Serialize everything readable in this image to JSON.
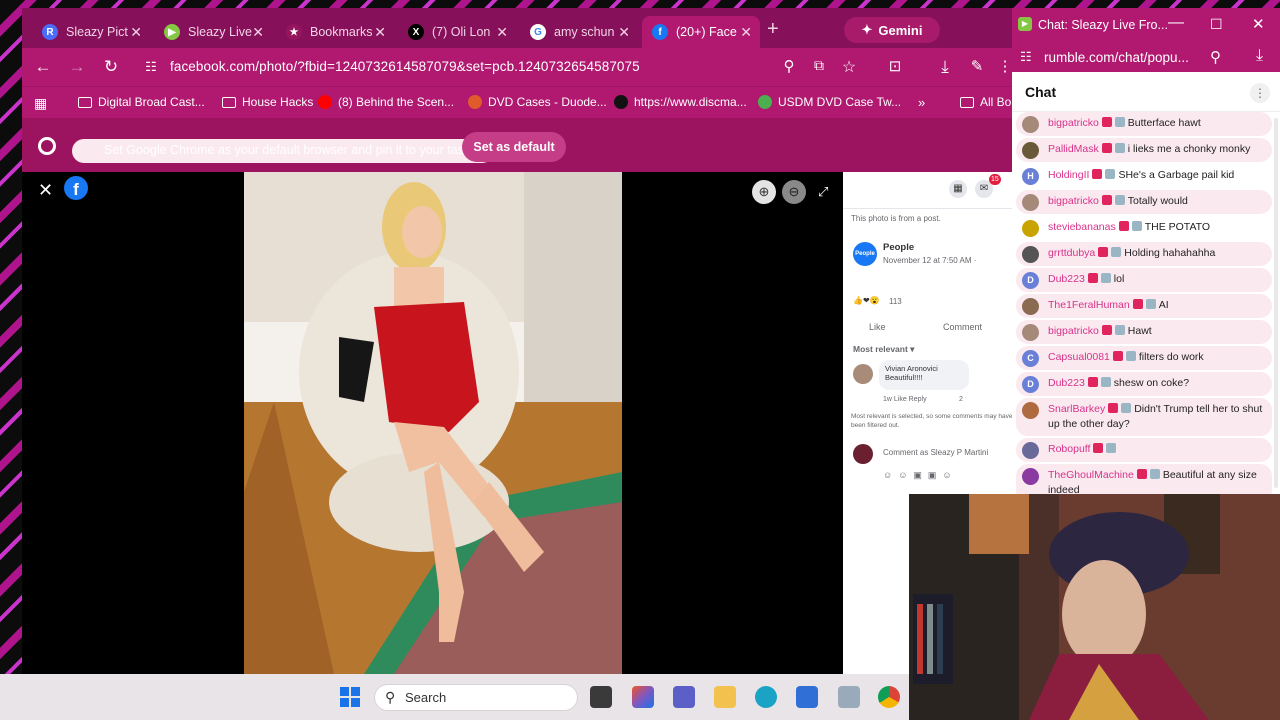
{
  "tabs": [
    {
      "label": "Sleazy Pict",
      "icon": "rumble-r-icon",
      "color": "#4a6cf7",
      "glyph": "R"
    },
    {
      "label": "Sleazy Live",
      "icon": "rumble-play-icon",
      "color": "#85c742",
      "glyph": "▶"
    },
    {
      "label": "Bookmarks",
      "icon": "star-icon",
      "color": "#95155f",
      "glyph": "★"
    },
    {
      "label": "(7) Oli Lon",
      "icon": "x-icon",
      "color": "#000000",
      "glyph": "X"
    },
    {
      "label": "amy schun",
      "icon": "google-icon",
      "color": "#ffffff",
      "glyph": "G"
    },
    {
      "label": "(20+) Face",
      "icon": "facebook-icon",
      "color": "#1877f2",
      "glyph": "f"
    }
  ],
  "gemini_label": "Gemini",
  "address": "facebook.com/photo/?fbid=1240732614587079&set=pcb.1240732654587075",
  "bookmarks": [
    {
      "label": "Digital Broad Cast...",
      "icon": "folder-icon"
    },
    {
      "label": "House Hacks",
      "icon": "folder-icon"
    },
    {
      "label": "(8) Behind the Scen...",
      "icon": "youtube-icon"
    },
    {
      "label": "DVD Cases - Duode...",
      "icon": "site-icon"
    },
    {
      "label": "https://www.discma...",
      "icon": "site-icon"
    },
    {
      "label": "USDM DVD Case Tw...",
      "icon": "site-icon"
    },
    {
      "label": "All Bo",
      "icon": "folder-icon"
    }
  ],
  "infobar": {
    "message": "Set Google Chrome as your default browser and pin it to your taskbar",
    "button": "Set as default"
  },
  "fb_panel": {
    "notice": "This photo is from a post.",
    "page_name": "People",
    "post_time": "November 12 at 7:50 AM · ",
    "reaction_count": "113",
    "like": "Like",
    "comment": "Comment",
    "sort": "Most relevant ▾",
    "commenter": "Vivian Aronovici",
    "comment_text": "Beautiful!!!!",
    "comment_meta": "1w   Like   Reply",
    "comment_reacts": "2",
    "relevance_note": "Most relevant is selected, so some comments may have been filtered out.",
    "comment_placeholder": "Comment as Sleazy P Martini",
    "notif_count": "15"
  },
  "chat_window": {
    "title": "Chat: Sleazy Live Fro...",
    "url": "rumble.com/chat/popu...",
    "heading": "Chat"
  },
  "chat_messages": [
    {
      "user": "bigpatricko",
      "text": "Butterface hawt",
      "ucolor": "#d6338a",
      "av": "#a58a7a",
      "glyph": "",
      "bg": true
    },
    {
      "user": "PallidMask",
      "text": "i lieks me a chonky monky",
      "ucolor": "#d6338a",
      "av": "#6b5a3a",
      "glyph": "",
      "bg": true
    },
    {
      "user": "HoldingII",
      "text": "SHe's a Garbage pail kid",
      "ucolor": "#d6338a",
      "av": "#6a7fd6",
      "glyph": "H",
      "bg": false
    },
    {
      "user": "bigpatricko",
      "text": "Totally would",
      "ucolor": "#d6338a",
      "av": "#a58a7a",
      "glyph": "",
      "bg": true
    },
    {
      "user": "steviebananas",
      "text": "THE POTATO",
      "ucolor": "#d6338a",
      "av": "#c9a400",
      "glyph": "",
      "bg": false
    },
    {
      "user": "grrttdubya",
      "text": "Holding hahahahha",
      "ucolor": "#d6338a",
      "av": "#555555",
      "glyph": "",
      "bg": true
    },
    {
      "user": "Dub223",
      "text": "lol",
      "ucolor": "#d6338a",
      "av": "#6a7fd6",
      "glyph": "D",
      "bg": true
    },
    {
      "user": "The1FeralHuman",
      "text": "AI",
      "ucolor": "#d6338a",
      "av": "#8a6a50",
      "glyph": "",
      "bg": true
    },
    {
      "user": "bigpatricko",
      "text": "Hawt",
      "ucolor": "#d6338a",
      "av": "#a58a7a",
      "glyph": "",
      "bg": true
    },
    {
      "user": "Capsual0081",
      "text": "filters do work",
      "ucolor": "#d6338a",
      "av": "#6a7fd6",
      "glyph": "C",
      "bg": true
    },
    {
      "user": "Dub223",
      "text": "shesw on coke?",
      "ucolor": "#d6338a",
      "av": "#6a7fd6",
      "glyph": "D",
      "bg": true
    },
    {
      "user": "SnarlBarkey",
      "text": "Didn't Trump tell her to shut up the other day?",
      "ucolor": "#d6338a",
      "av": "#b06a40",
      "glyph": "",
      "bg": true
    },
    {
      "user": "Robopuff",
      "text": "",
      "ucolor": "#d6338a",
      "av": "#6a6a9a",
      "glyph": "",
      "bg": true
    },
    {
      "user": "TheGhoulMachine",
      "text": "Beautiful at any size indeed",
      "ucolor": "#d6338a",
      "av": "#8a3aa0",
      "glyph": "",
      "bg": true
    }
  ],
  "taskbar": {
    "search_placeholder": "Search"
  }
}
